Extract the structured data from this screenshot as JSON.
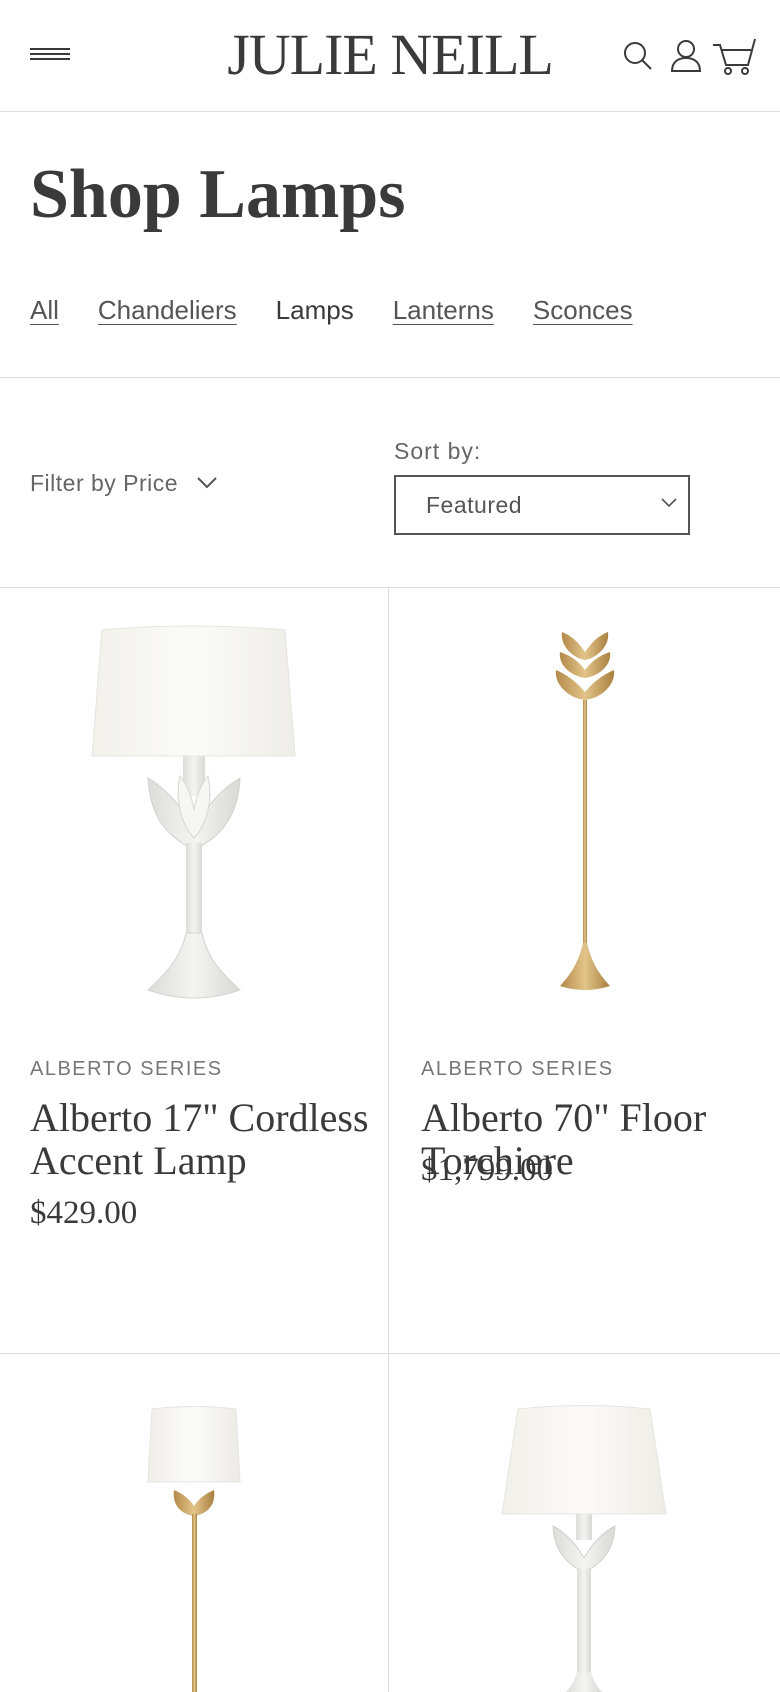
{
  "header": {
    "logo": "JULIE NEILL",
    "icons": [
      "menu-icon",
      "search-icon",
      "account-icon",
      "cart-icon"
    ]
  },
  "page": {
    "title": "Shop Lamps"
  },
  "categories": [
    {
      "label": "All",
      "active": false
    },
    {
      "label": "Chandeliers",
      "active": false
    },
    {
      "label": "Lamps",
      "active": true
    },
    {
      "label": "Lanterns",
      "active": false
    },
    {
      "label": "Sconces",
      "active": false
    }
  ],
  "filter": {
    "label": "Filter by Price"
  },
  "sort": {
    "label": "Sort by:",
    "selected": "Featured"
  },
  "products": [
    {
      "series": "ALBERTO SERIES",
      "name": "Alberto 17\" Cordless Accent Lamp",
      "price": "$429.00",
      "finish": "white plaster"
    },
    {
      "series": "ALBERTO SERIES",
      "name": "Alberto 70\" Floor Torchiere",
      "price": "$1,799.00",
      "finish": "antique brass"
    },
    {
      "series": "",
      "name": "",
      "price": "",
      "finish": "antique brass with linen shade"
    },
    {
      "series": "",
      "name": "",
      "price": "",
      "finish": "white plaster with linen shade"
    }
  ],
  "colors": {
    "text": "#3a3a3a",
    "muted": "#777777",
    "divider": "#dcdcdc",
    "brass": "#c9a25e",
    "plaster": "#ebebe8"
  }
}
